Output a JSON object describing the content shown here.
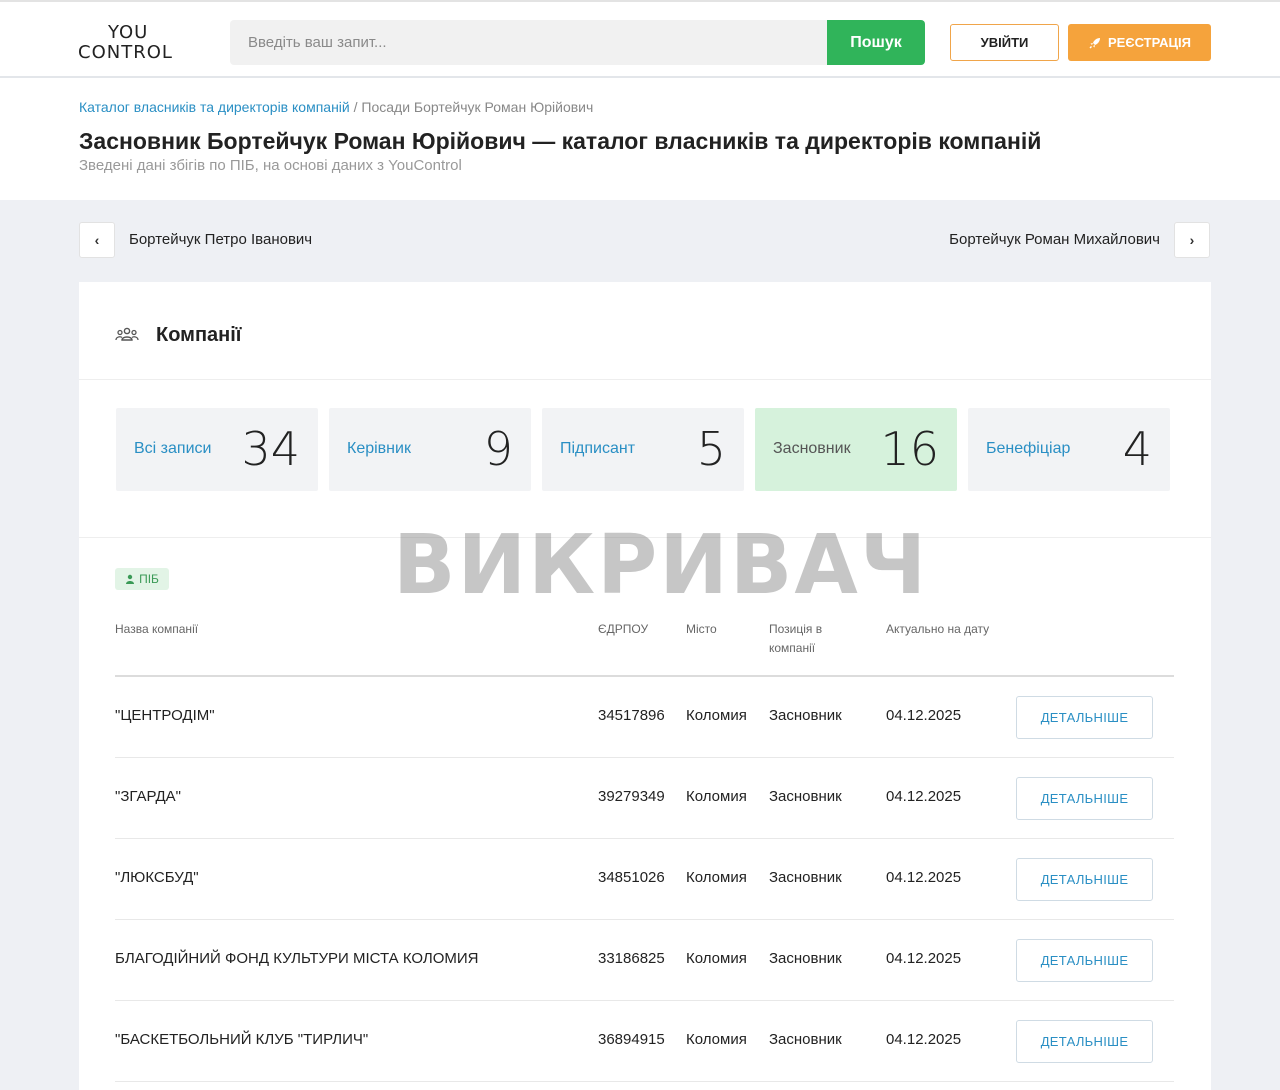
{
  "header": {
    "logo_top": "YOU",
    "logo_bottom": "CONTROL",
    "search_placeholder": "Введіть ваш запит...",
    "search_button": "Пошук",
    "login_button": "УВІЙТИ",
    "register_button": "РЕЄСТРАЦІЯ"
  },
  "breadcrumb": {
    "link": "Каталог власників та директорів компаній",
    "separator": " / ",
    "current": "Посади Бортейчук Роман Юрійович"
  },
  "page": {
    "title": "Засновник Бортейчук Роман Юрійович — каталог власників та директорів компаній",
    "subtitle": "Зведені дані збігів по ПІБ, на основі даних з YouControl"
  },
  "nav": {
    "prev_label": "Бортейчук Петро Іванович",
    "next_label": "Бортейчук Роман Михайлович"
  },
  "section": {
    "title": "Компанії",
    "tag": "ПІБ",
    "watermark": "ВИКРИВАЧ"
  },
  "stats": [
    {
      "label": "Всі записи",
      "value": "34"
    },
    {
      "label": "Керівник",
      "value": "9"
    },
    {
      "label": "Підписант",
      "value": "5"
    },
    {
      "label": "Засновник",
      "value": "16"
    },
    {
      "label": "Бенефіціар",
      "value": "4"
    }
  ],
  "table": {
    "headers": {
      "name": "Назва компанії",
      "code": "ЄДРПОУ",
      "city": "Місто",
      "position_1": "Позиція в",
      "position_2": "компанії",
      "date": "Актуально на дату"
    },
    "rows": [
      {
        "name": "\"ЦЕНТРОДІМ\"",
        "code": "34517896",
        "city": "Коломия",
        "position": "Засновник",
        "date": "04.12.2025",
        "button": "ДЕТАЛЬНІШЕ"
      },
      {
        "name": "\"ЗГАРДА\"",
        "code": "39279349",
        "city": "Коломия",
        "position": "Засновник",
        "date": "04.12.2025",
        "button": "ДЕТАЛЬНІШЕ"
      },
      {
        "name": "\"ЛЮКСБУД\"",
        "code": "34851026",
        "city": "Коломия",
        "position": "Засновник",
        "date": "04.12.2025",
        "button": "ДЕТАЛЬНІШЕ"
      },
      {
        "name": "БЛАГОДІЙНИЙ ФОНД КУЛЬТУРИ МІСТА КОЛОМИЯ",
        "code": "33186825",
        "city": "Коломия",
        "position": "Засновник",
        "date": "04.12.2025",
        "button": "ДЕТАЛЬНІШЕ"
      },
      {
        "name": "\"БАСКЕТБОЛЬНИЙ КЛУБ \"ТИРЛИЧ\"",
        "code": "36894915",
        "city": "Коломия",
        "position": "Засновник",
        "date": "04.12.2025",
        "button": "ДЕТАЛЬНІШЕ"
      }
    ]
  },
  "colors": {
    "accent_blue": "#2a8fc4",
    "search_green": "#30b45a",
    "register_orange": "#f5a33c",
    "active_stat_bg": "#d6f2dc"
  }
}
